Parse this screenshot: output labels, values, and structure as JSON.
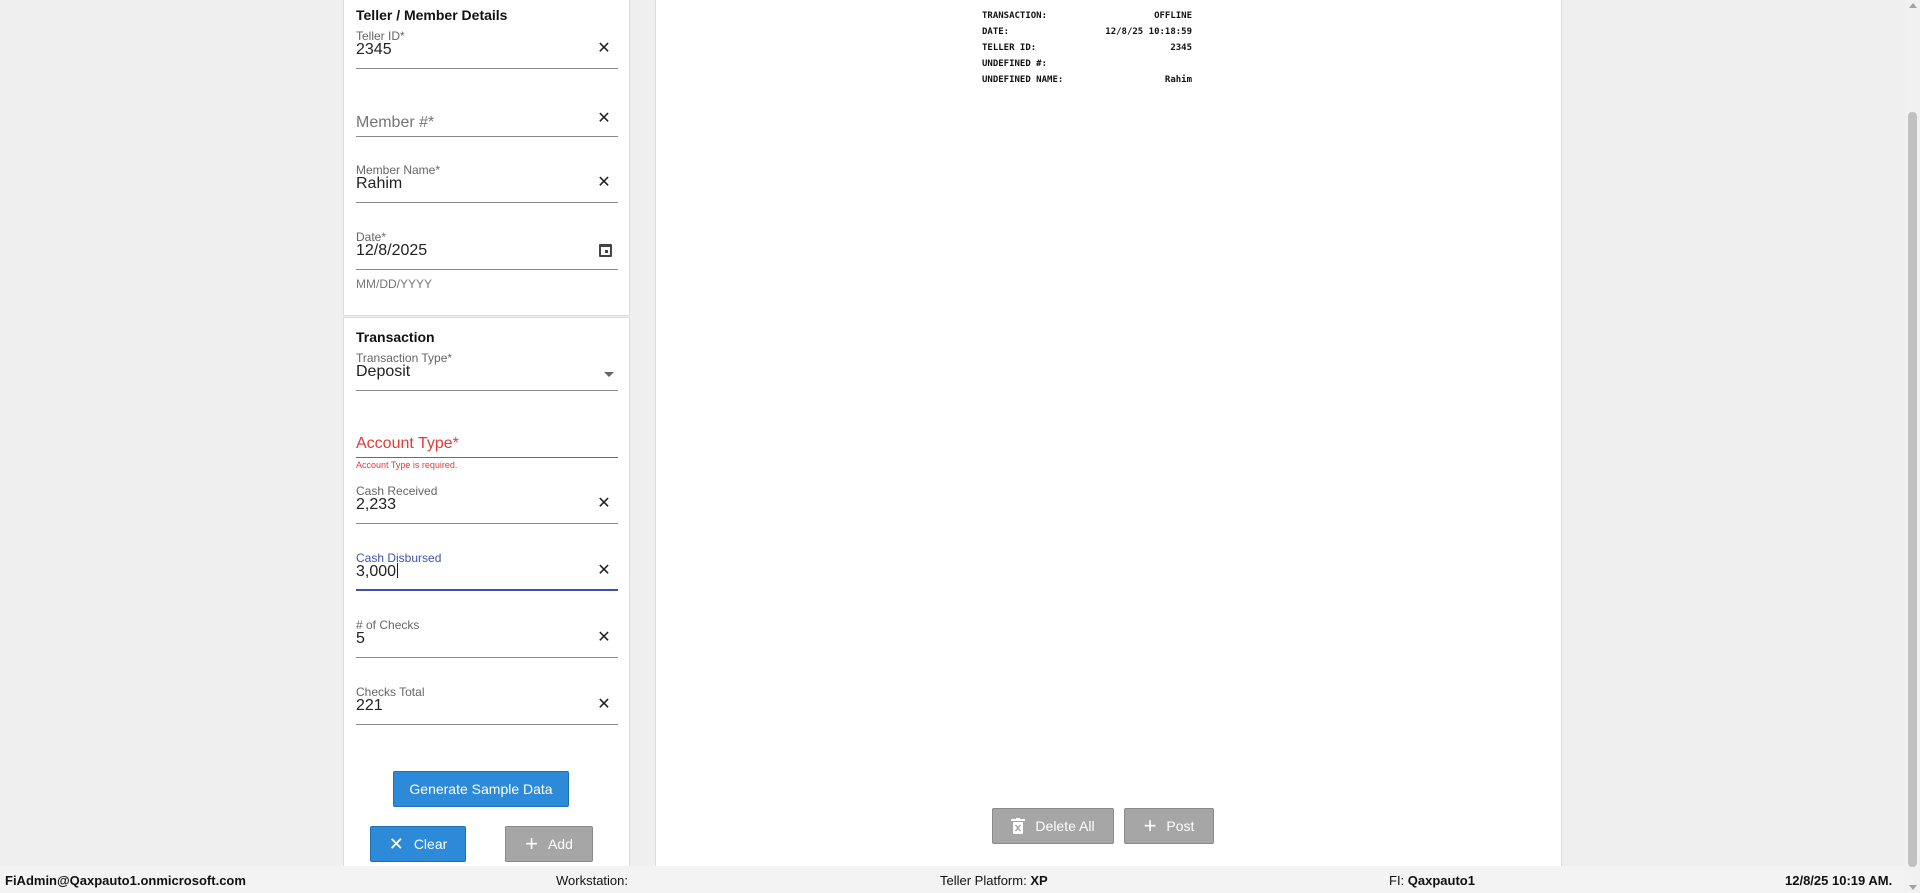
{
  "teller_section": {
    "title": "Teller / Member Details",
    "teller_id": {
      "label": "Teller ID*",
      "value": "2345"
    },
    "member_number": {
      "placeholder": "Member #*"
    },
    "member_name": {
      "label": "Member Name*",
      "value": "Rahim"
    },
    "date": {
      "label": "Date*",
      "value": "12/8/2025",
      "hint": "MM/DD/YYYY"
    }
  },
  "transaction_section": {
    "title": "Transaction",
    "transaction_type": {
      "label": "Transaction Type*",
      "value": "Deposit"
    },
    "account_type": {
      "placeholder": "Account Type*",
      "error": "Account Type is required."
    },
    "cash_received": {
      "label": "Cash Received",
      "value": "2,233"
    },
    "cash_disbursed": {
      "label": "Cash Disbursed",
      "value": "3,000"
    },
    "num_checks": {
      "label": "# of Checks",
      "value": "5"
    },
    "checks_total": {
      "label": "Checks Total",
      "value": "221"
    }
  },
  "buttons": {
    "generate_sample": "Generate Sample Data",
    "clear": "Clear",
    "add": "Add",
    "delete_all": "Delete All",
    "post": "Post"
  },
  "receipt": {
    "rows": [
      {
        "label": "TRANSACTION:",
        "value": "OFFLINE"
      },
      {
        "label": "DATE:",
        "value": "12/8/25 10:18:59"
      },
      {
        "label": "TELLER ID:",
        "value": "2345"
      },
      {
        "label": "UNDEFINED #:",
        "value": ""
      },
      {
        "label": "UNDEFINED NAME:",
        "value": "Rahim"
      }
    ]
  },
  "statusbar": {
    "user": "FiAdmin@Qaxpauto1.onmicrosoft.com",
    "workstation_label": "Workstation:",
    "workstation_value": "",
    "platform_label": "Teller Platform:",
    "platform_value": "XP",
    "fi_label": "FI:",
    "fi_value": "Qaxpauto1",
    "datetime": "12/8/25 10:19 AM."
  },
  "colors": {
    "primary_button": "#2d8ad8",
    "disabled_button": "#a6a6a6",
    "error": "#e53935",
    "focus": "#3f51b5"
  },
  "icons": {
    "clear_field": "close-icon",
    "date_picker": "calendar-icon",
    "dropdown": "chevron-down-icon",
    "clear_button": "close-icon",
    "add_button": "plus-icon",
    "delete_all_button": "trash-icon",
    "post_button": "plus-icon"
  }
}
